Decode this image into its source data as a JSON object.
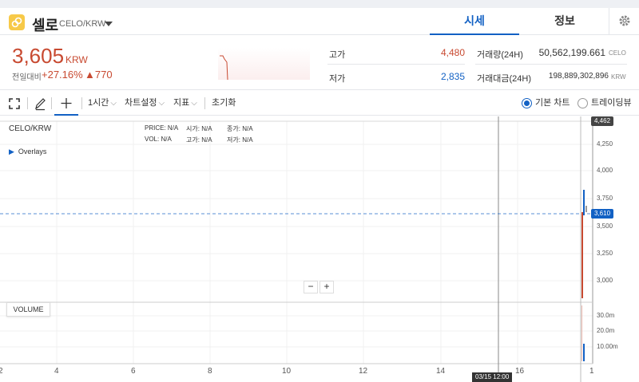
{
  "header": {
    "coin_name": "셀로",
    "coin_pair": "CELO/KRW",
    "tabs": [
      "시세",
      "정보"
    ]
  },
  "price": {
    "current": "3,605",
    "unit": "KRW",
    "change_label": "전일대비",
    "change_rate": "+27.16%",
    "change_amount": "▲770"
  },
  "stats": {
    "high_label": "고가",
    "high_value": "4,480",
    "low_label": "저가",
    "low_value": "2,835",
    "volume_label": "거래량(24H)",
    "volume_value": "50,562,199.661",
    "volume_unit": "CELO",
    "amount_label": "거래대금(24H)",
    "amount_value": "198,889,302,896",
    "amount_unit": "KRW"
  },
  "toolbar": {
    "interval": "1시간",
    "chart_settings": "차트설정",
    "indicators": "지표",
    "reset": "초기화",
    "basic_chart": "기본 차트",
    "tradingview": "트레이딩뷰"
  },
  "chart": {
    "symbol": "CELO/KRW",
    "overlays_label": "Overlays",
    "legend_row1": [
      [
        "PRICE:",
        "N/A"
      ],
      [
        "시가:",
        "N/A"
      ],
      [
        "종가:",
        "N/A"
      ]
    ],
    "legend_row2": [
      [
        "VOL:",
        "N/A"
      ],
      [
        "고가:",
        "N/A"
      ],
      [
        "저가:",
        "N/A"
      ]
    ],
    "volume_label": "VOLUME",
    "zoom_out": "−",
    "zoom_in": "+",
    "price_ticks": [
      "4,250",
      "4,000",
      "3,750",
      "3,500",
      "3,250",
      "3,000"
    ],
    "volume_ticks": [
      "30.0m",
      "20.0m",
      "10.00m"
    ],
    "x_ticks": [
      "2",
      "4",
      "6",
      "8",
      "10",
      "12",
      "14",
      "16",
      "1"
    ],
    "high_tag": "4,462",
    "current_tag": "3,610",
    "crosshair_time": "03/15 12:00"
  },
  "colors": {
    "up": "#c84a31",
    "down": "#1261c4",
    "accent": "#1261c4",
    "logo": "#f7c948"
  }
}
